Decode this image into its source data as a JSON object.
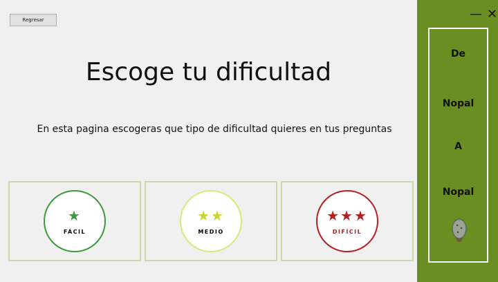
{
  "header": {
    "back_label": "Regresar"
  },
  "main": {
    "title": "Escoge tu dificultad",
    "description": "En esta pagina escogeras que tipo de dificultad quieres en tus preguntas"
  },
  "difficulties": [
    {
      "label": "FÁCIL",
      "stars": "★",
      "color": "#3c9a3c"
    },
    {
      "label": "MEDIO",
      "stars": "★★",
      "color": "#c7d62e"
    },
    {
      "label": "DIFÍCIL",
      "stars": "★★★",
      "color": "#b32020"
    }
  ],
  "window_controls": {
    "minimize": "—",
    "close": "✕"
  },
  "sidebar": {
    "words": [
      "De",
      "Nopal",
      "A",
      "Nopal"
    ],
    "icon": "cactus-leaf-icon"
  },
  "colors": {
    "sidebar_bg": "#6b8e23",
    "main_bg": "#f0f0f0",
    "card_border": "#cdd7a8"
  }
}
